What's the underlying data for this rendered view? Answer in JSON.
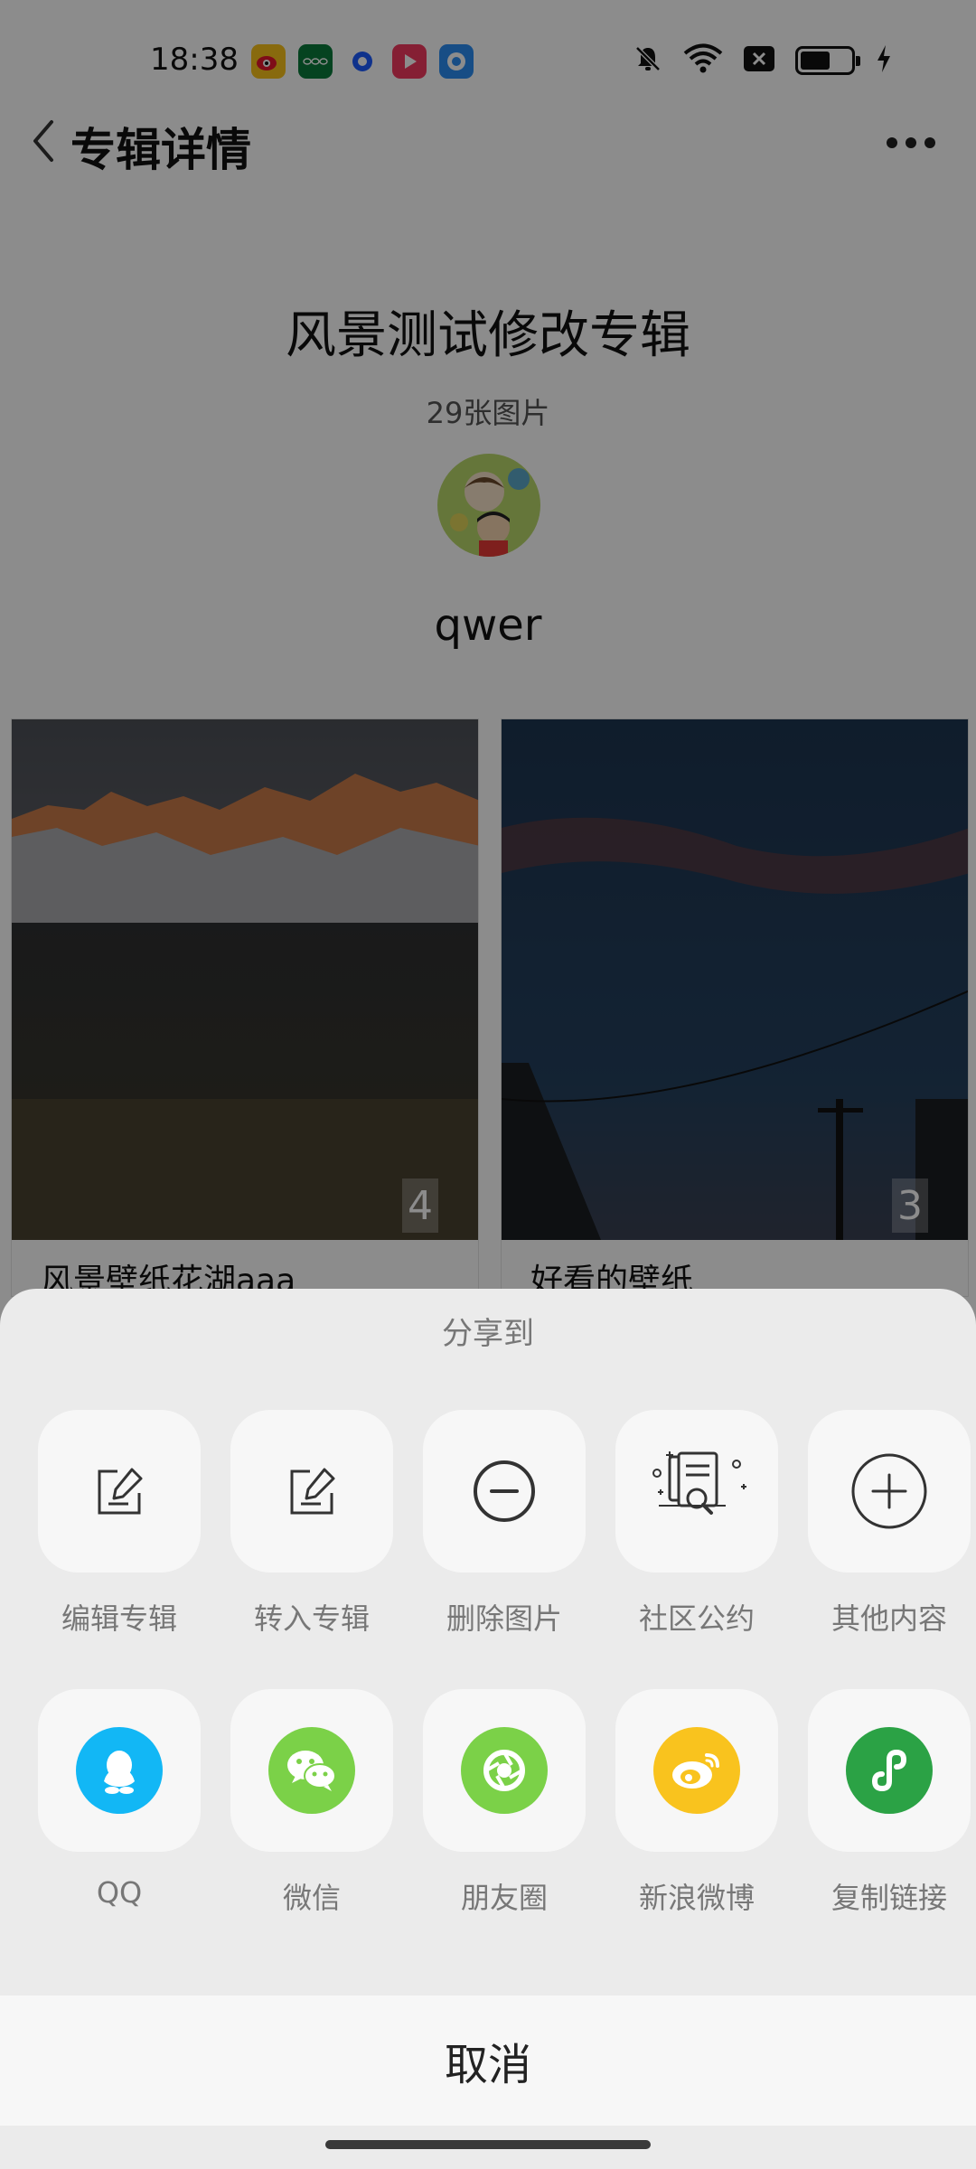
{
  "status_bar": {
    "time": "18:38",
    "app_icons": [
      "weibo-icon",
      "oppo-icon",
      "circle-app-icon",
      "video-app-icon",
      "browser-app-icon"
    ],
    "indicators": [
      "mute-icon",
      "wifi-icon",
      "x-icon",
      "battery-icon",
      "charging-icon"
    ]
  },
  "header": {
    "title": "专辑详情"
  },
  "album": {
    "title": "风景测试修改专辑",
    "count": "29张图片",
    "author": "qwer"
  },
  "photos": [
    {
      "caption": "风景壁纸花湖aaa",
      "badge": "4"
    },
    {
      "caption": "好看的壁纸",
      "badge": "3"
    }
  ],
  "share_sheet": {
    "title": "分享到",
    "row1": [
      {
        "label": "编辑专辑",
        "icon": "edit-icon"
      },
      {
        "label": "转入专辑",
        "icon": "move-icon"
      },
      {
        "label": "删除图片",
        "icon": "minus-circle-icon"
      },
      {
        "label": "社区公约",
        "icon": "document-search-icon"
      },
      {
        "label": "其他内容",
        "icon": "plus-circle-icon"
      }
    ],
    "row2": [
      {
        "label": "QQ",
        "icon": "qq-icon",
        "color": "#12B7F5"
      },
      {
        "label": "微信",
        "icon": "wechat-icon",
        "color": "#7BD148"
      },
      {
        "label": "朋友圈",
        "icon": "moments-icon",
        "color": "#7BD148"
      },
      {
        "label": "新浪微博",
        "icon": "weibo-icon",
        "color": "#F9C31E"
      },
      {
        "label": "复制链接",
        "icon": "mini-program-icon",
        "color": "#2BA245"
      }
    ],
    "cancel": "取消"
  }
}
